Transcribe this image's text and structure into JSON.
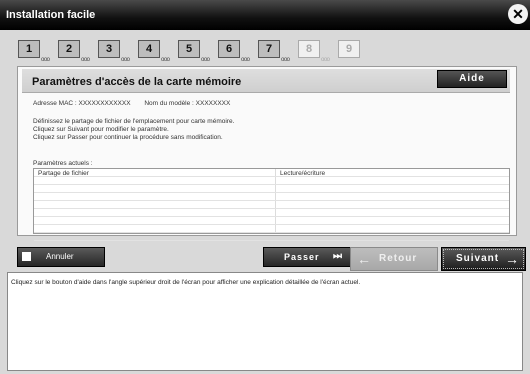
{
  "window": {
    "title": "Installation facile",
    "close_glyph": "✕"
  },
  "steps": [
    {
      "num": "1",
      "sub": "ooo",
      "state": "done"
    },
    {
      "num": "2",
      "sub": "ooo",
      "state": "done"
    },
    {
      "num": "3",
      "sub": "ooo",
      "state": "done"
    },
    {
      "num": "4",
      "sub": "ooo",
      "state": "done"
    },
    {
      "num": "5",
      "sub": "ooo",
      "state": "done"
    },
    {
      "num": "6",
      "sub": "ooo",
      "state": "done"
    },
    {
      "num": "7",
      "sub": "ooo",
      "state": "current"
    },
    {
      "num": "8",
      "sub": "ooo",
      "state": "todo"
    },
    {
      "num": "9",
      "sub": "",
      "state": "todo"
    }
  ],
  "panel": {
    "heading": "Paramètres d'accès de la carte mémoire",
    "help_button": "Aide",
    "mac_label": "Adresse MAC : XXXXXXXXXXXX",
    "model_label": "Nom du modèle : XXXXXXXX",
    "description": [
      "Définissez le partage de fichier de l'emplacement pour carte mémoire.",
      "Cliquez sur Suivant pour modifier le paramètre.",
      "Cliquez sur Passer pour continuer la procédure sans modification."
    ],
    "current_params_label": "Paramètres actuels :",
    "table": {
      "columns": [
        "Partage de fichier",
        "Lecture/écriture"
      ],
      "rows": [
        [
          "",
          ""
        ],
        [
          "",
          ""
        ],
        [
          "",
          ""
        ],
        [
          "",
          ""
        ],
        [
          "",
          ""
        ],
        [
          "",
          ""
        ],
        [
          "",
          ""
        ],
        [
          "",
          ""
        ]
      ]
    }
  },
  "buttons": {
    "cancel": "Annuler",
    "skip": "Passer",
    "skip_icon": "⏭",
    "back": "Retour",
    "back_icon": "←",
    "next": "Suivant",
    "next_icon": "→"
  },
  "help_text": "Cliquez sur le bouton d'aide dans l'angle supérieur droit de l'écran pour afficher une explication détaillée de l'écran actuel."
}
